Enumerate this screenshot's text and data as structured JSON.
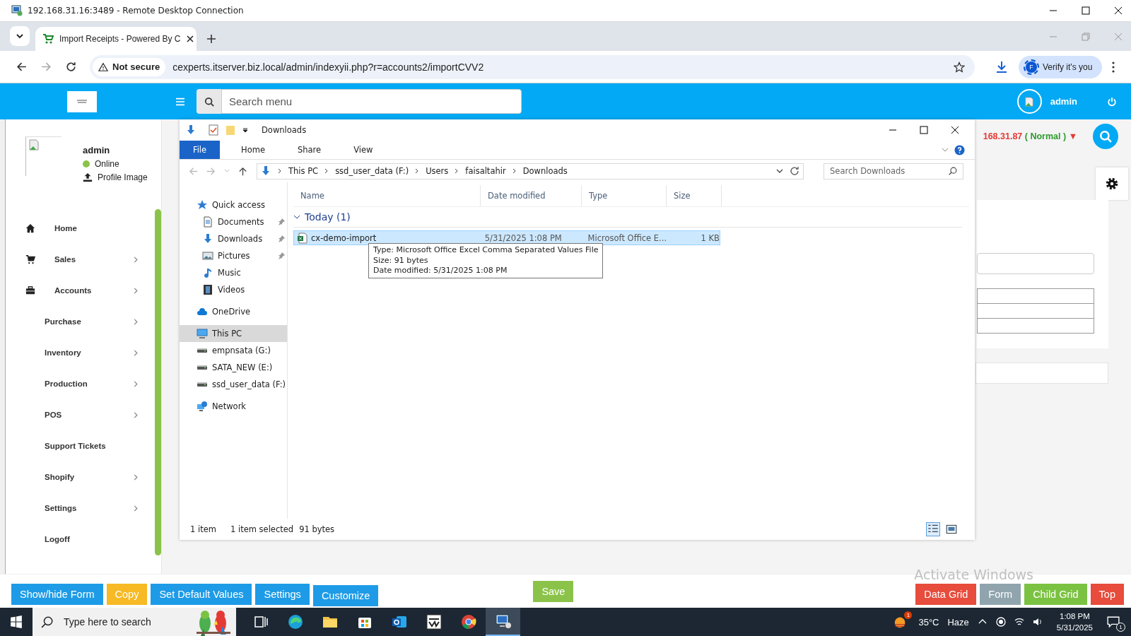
{
  "rdp": {
    "title": "192.168.31.16:3489 - Remote Desktop Connection"
  },
  "browser": {
    "tab_title": "Import Receipts - Powered By C",
    "security": "Not secure",
    "url": "cexperts.itserver.biz.local/admin/indexyii.php?r=accounts2/importCVV2",
    "profile_initial": "F",
    "profile_button": "Verify it's you"
  },
  "header": {
    "search_placeholder": "Search menu",
    "user": "admin"
  },
  "sidebar": {
    "user": "admin",
    "status": "Online",
    "profile_link": "Profile Image",
    "items": [
      {
        "label": "Home",
        "kind": "home",
        "submenu": false
      },
      {
        "label": "Sales",
        "kind": "cart",
        "submenu": true
      },
      {
        "label": "Accounts",
        "kind": "briefcase",
        "submenu": true
      },
      {
        "label": "Purchase",
        "kind": "text",
        "submenu": true
      },
      {
        "label": "Inventory",
        "kind": "text",
        "submenu": true
      },
      {
        "label": "Production",
        "kind": "text",
        "submenu": true
      },
      {
        "label": "POS",
        "kind": "text",
        "submenu": true
      },
      {
        "label": "Support Tickets",
        "kind": "text",
        "submenu": false
      },
      {
        "label": "Shopify",
        "kind": "text",
        "submenu": true
      },
      {
        "label": "Settings",
        "kind": "text",
        "submenu": true
      },
      {
        "label": "Logoff",
        "kind": "text",
        "submenu": false
      }
    ]
  },
  "page": {
    "server": "168.31.87",
    "mode": "( Normal )",
    "caret": "▼"
  },
  "explorer": {
    "title": "Downloads",
    "ribbon_tabs": [
      {
        "label": "File",
        "selected": true
      },
      {
        "label": "Home",
        "selected": false
      },
      {
        "label": "Share",
        "selected": false
      },
      {
        "label": "View",
        "selected": false
      }
    ],
    "path": [
      "This PC",
      "ssd_user_data (F:)",
      "Users",
      "faisaltahir",
      "Downloads"
    ],
    "search_placeholder": "Search Downloads",
    "nav": [
      {
        "label": "Quick access",
        "kind": "star",
        "selected": false,
        "children": [
          {
            "label": "Documents",
            "kind": "document",
            "pinned": true,
            "selected": false
          },
          {
            "label": "Downloads",
            "kind": "download",
            "pinned": true,
            "selected": false
          },
          {
            "label": "Pictures",
            "kind": "pictures",
            "pinned": true,
            "selected": false
          },
          {
            "label": "Music",
            "kind": "music",
            "pinned": false,
            "selected": false
          },
          {
            "label": "Videos",
            "kind": "videos",
            "pinned": false,
            "selected": false
          }
        ]
      },
      {
        "label": "OneDrive",
        "kind": "cloud",
        "selected": false
      },
      {
        "label": "This PC",
        "kind": "computer",
        "selected": true
      },
      {
        "label": "empnsata (G:)",
        "kind": "drive",
        "selected": false
      },
      {
        "label": "SATA_NEW (E:)",
        "kind": "drive",
        "selected": false
      },
      {
        "label": "ssd_user_data (F:)",
        "kind": "drive",
        "selected": false
      },
      {
        "label": "Network",
        "kind": "network",
        "selected": false
      }
    ],
    "columns": [
      "Name",
      "Date modified",
      "Type",
      "Size"
    ],
    "groups": [
      {
        "label": "Today (1)",
        "expanded": true,
        "files": [
          {
            "name": "cx-demo-import",
            "date": "5/31/2025 1:08 PM",
            "type": "Microsoft Office E...",
            "size": "1 KB",
            "selected": true
          }
        ]
      }
    ],
    "tooltip": [
      "Type: Microsoft Office Excel Comma Separated Values File",
      "Size: 91 bytes",
      "Date modified: 5/31/2025 1:08 PM"
    ],
    "status": {
      "count": "1 item",
      "selection": "1 item selected",
      "selection_size": "91 bytes"
    }
  },
  "actions": [
    {
      "label": "Show/hide Form",
      "color": "#1e9be6"
    },
    {
      "label": "Copy",
      "color": "#f7b924"
    },
    {
      "label": "Set Default Values",
      "color": "#1e9be6"
    },
    {
      "label": "Settings",
      "color": "#1e9be6"
    },
    {
      "label": "Customize",
      "color": "#1e9be6"
    }
  ],
  "save": {
    "label": "Save",
    "color": "#8bc34a"
  },
  "views": [
    {
      "label": "Data Grid",
      "color": "#e74c3c"
    },
    {
      "label": "Form",
      "color": "#90a4ae"
    },
    {
      "label": "Child Grid",
      "color": "#7cc242"
    },
    {
      "label": "Top",
      "color": "#e74c3c"
    }
  ],
  "os_notice": "Activate Windows",
  "taskbar": {
    "search_placeholder": "Type here to search",
    "apps": [
      {
        "kind": "taskview",
        "selected": false
      },
      {
        "kind": "edge",
        "selected": false
      },
      {
        "kind": "folder",
        "selected": false
      },
      {
        "kind": "store",
        "selected": false
      },
      {
        "kind": "outlook",
        "selected": false
      },
      {
        "kind": "vnc",
        "selected": false
      },
      {
        "kind": "chrome",
        "selected": false
      },
      {
        "kind": "remote",
        "selected": true
      }
    ],
    "weather_alert": "1",
    "temperature": "35°C",
    "condition": "Haze",
    "time": "1:08 PM",
    "date": "5/31/2025",
    "notifications": "1"
  }
}
